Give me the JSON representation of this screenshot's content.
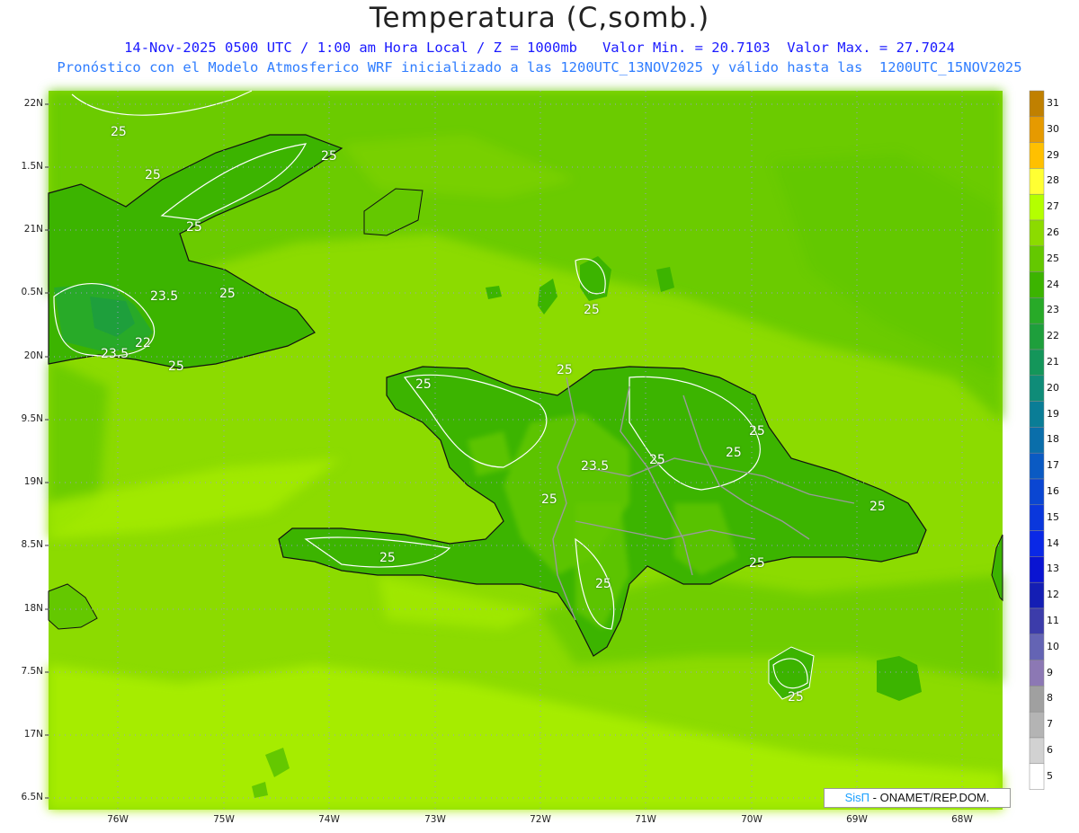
{
  "title": "Temperatura (C,somb.)",
  "subtitle_line1": "14-Nov-2025 0500 UTC / 1:00 am Hora Local / Z = 1000mb   Valor Min. = 20.7103  Valor Max. = 27.7024",
  "subtitle_line2": "Pronóstico con el Modelo Atmosferico WRF inicializado a las 1200UTC_13NOV2025 y válido hasta las  1200UTC_15NOV2025",
  "lat_labels": [
    "22N",
    "1.5N",
    "21N",
    "0.5N",
    "20N",
    "9.5N",
    "19N",
    "8.5N",
    "18N",
    "7.5N",
    "17N",
    "6.5N"
  ],
  "lon_labels": [
    "76W",
    "75W",
    "74W",
    "73W",
    "72W",
    "71W",
    "70W",
    "69W",
    "68W"
  ],
  "colorbar": {
    "labels": [
      "31",
      "30",
      "29",
      "28",
      "27",
      "26",
      "25",
      "24",
      "23",
      "22",
      "21",
      "20",
      "19",
      "18",
      "17",
      "16",
      "15",
      "14",
      "13",
      "12",
      "11",
      "10",
      "9",
      "8",
      "7",
      "6",
      "5"
    ],
    "colors": [
      "#c08000",
      "#e69a00",
      "#ffc000",
      "#ffff33",
      "#b4ff00",
      "#8cdb00",
      "#64c800",
      "#3cb400",
      "#28aa28",
      "#1e9f3c",
      "#14965a",
      "#0f8c78",
      "#0a7d96",
      "#0a6eaa",
      "#0a5ac3",
      "#0a46d2",
      "#0a37dc",
      "#0a28e6",
      "#0a14d2",
      "#141eb4",
      "#3c3caa",
      "#6464b4",
      "#8c78b4",
      "#a0a0a0",
      "#b4b4b4",
      "#d2d2d2",
      "#ffffff"
    ]
  },
  "credit": {
    "logo": "SisΠ",
    "text": " - ONAMET/REP.DOM."
  },
  "contour_labels": [
    "25",
    "25",
    "25",
    "25",
    "23.5",
    "25",
    "23.5",
    "22",
    "25",
    "25",
    "25",
    "25",
    "25",
    "25",
    "23.5",
    "25",
    "25",
    "25",
    "25",
    "25",
    "25",
    "25"
  ]
}
